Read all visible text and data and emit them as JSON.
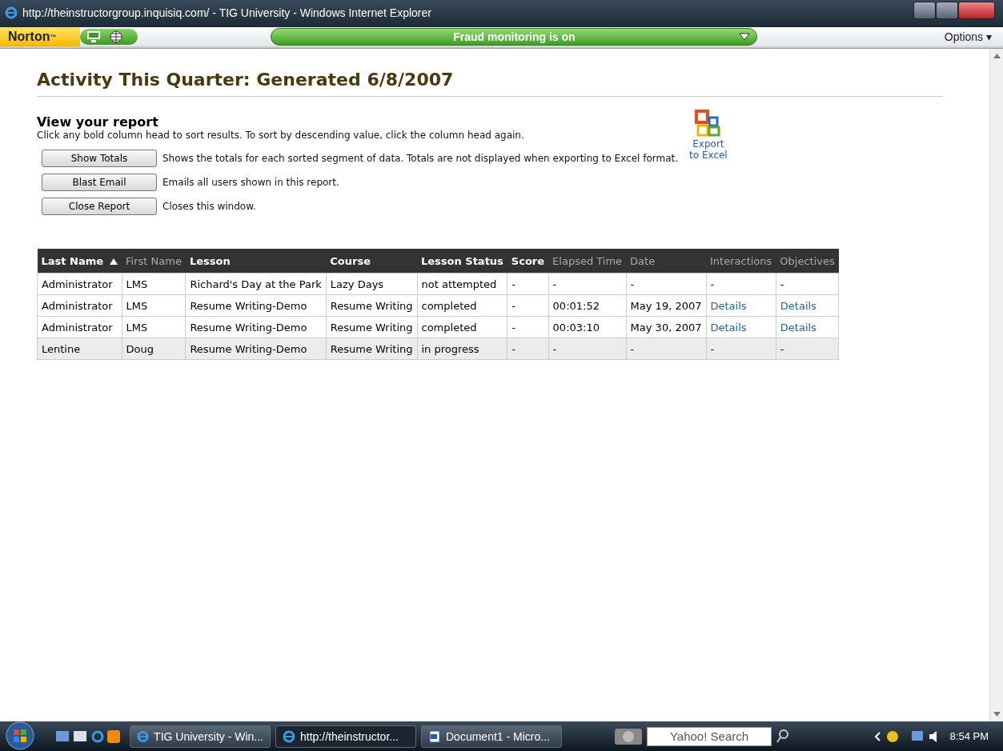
{
  "window": {
    "title": "http://theinstructorgroup.inquisiq.com/ - TIG University - Windows Internet Explorer"
  },
  "norton": {
    "brand": "Norton",
    "brand_mark": "™",
    "status": "Fraud monitoring is on",
    "options": "Options ▾"
  },
  "page": {
    "title": "Activity This Quarter: Generated 6/8/2007",
    "subtitle": "View your report",
    "hint": "Click any bold column head to sort results. To sort by descending value, click the column head again.",
    "actions": [
      {
        "button": "Show Totals",
        "description": "Shows the totals for each sorted segment of data. Totals are not displayed when exporting to Excel format."
      },
      {
        "button": "Blast Email",
        "description": "Emails all users shown in this report."
      },
      {
        "button": "Close Report",
        "description": "Closes this window."
      }
    ],
    "export": [
      "Export",
      "to Excel"
    ]
  },
  "table": {
    "columns": [
      {
        "label": "Last Name",
        "sortable": true,
        "sorted": true
      },
      {
        "label": "First Name",
        "sortable": false,
        "sorted": false
      },
      {
        "label": "Lesson",
        "sortable": true,
        "sorted": false
      },
      {
        "label": "Course",
        "sortable": true,
        "sorted": false
      },
      {
        "label": "Lesson Status",
        "sortable": true,
        "sorted": false
      },
      {
        "label": "Score",
        "sortable": true,
        "sorted": false
      },
      {
        "label": "Elapsed Time",
        "sortable": false,
        "sorted": false
      },
      {
        "label": "Date",
        "sortable": false,
        "sorted": false
      },
      {
        "label": "Interactions",
        "sortable": false,
        "sorted": false
      },
      {
        "label": "Objectives",
        "sortable": false,
        "sorted": false
      }
    ],
    "rows": [
      {
        "shaded": false,
        "cells": [
          {
            "kind": "text",
            "text": "Administrator"
          },
          {
            "kind": "text",
            "text": "LMS"
          },
          {
            "kind": "text",
            "text": "Richard's Day at the Park"
          },
          {
            "kind": "text",
            "text": "Lazy Days"
          },
          {
            "kind": "text",
            "text": "not attempted"
          },
          {
            "kind": "text",
            "text": "-"
          },
          {
            "kind": "text",
            "text": "-"
          },
          {
            "kind": "text",
            "text": "-"
          },
          {
            "kind": "text",
            "text": "-"
          },
          {
            "kind": "text",
            "text": "-"
          }
        ]
      },
      {
        "shaded": false,
        "cells": [
          {
            "kind": "text",
            "text": "Administrator"
          },
          {
            "kind": "text",
            "text": "LMS"
          },
          {
            "kind": "text",
            "text": "Resume Writing-Demo"
          },
          {
            "kind": "text",
            "text": "Resume Writing"
          },
          {
            "kind": "text",
            "text": "completed"
          },
          {
            "kind": "text",
            "text": "-"
          },
          {
            "kind": "text",
            "text": "00:01:52"
          },
          {
            "kind": "text",
            "text": "May 19, 2007"
          },
          {
            "kind": "link",
            "text": "Details"
          },
          {
            "kind": "link",
            "text": "Details"
          }
        ]
      },
      {
        "shaded": false,
        "cells": [
          {
            "kind": "text",
            "text": "Administrator"
          },
          {
            "kind": "text",
            "text": "LMS"
          },
          {
            "kind": "text",
            "text": "Resume Writing-Demo"
          },
          {
            "kind": "text",
            "text": "Resume Writing"
          },
          {
            "kind": "text",
            "text": "completed"
          },
          {
            "kind": "text",
            "text": "-"
          },
          {
            "kind": "text",
            "text": "00:03:10"
          },
          {
            "kind": "text",
            "text": "May 30, 2007"
          },
          {
            "kind": "link",
            "text": "Details"
          },
          {
            "kind": "link",
            "text": "Details"
          }
        ]
      },
      {
        "shaded": true,
        "cells": [
          {
            "kind": "text",
            "text": "Lentine"
          },
          {
            "kind": "text",
            "text": "Doug"
          },
          {
            "kind": "text",
            "text": "Resume Writing-Demo"
          },
          {
            "kind": "text",
            "text": "Resume Writing"
          },
          {
            "kind": "text",
            "text": "in progress"
          },
          {
            "kind": "text",
            "text": "-"
          },
          {
            "kind": "text",
            "text": "-"
          },
          {
            "kind": "text",
            "text": "-"
          },
          {
            "kind": "text",
            "text": "-"
          },
          {
            "kind": "text",
            "text": "-"
          }
        ]
      }
    ]
  },
  "taskbar": {
    "tasks": [
      {
        "label": "TIG University - Win...",
        "selected": false,
        "kind": "browser"
      },
      {
        "label": "http://theinstructor...",
        "selected": true,
        "kind": "browser"
      },
      {
        "label": "Document1 - Micro...",
        "selected": false,
        "kind": "document"
      }
    ],
    "search": {
      "placeholder": "Yahoo! Search"
    },
    "clock": "8:54 PM"
  }
}
